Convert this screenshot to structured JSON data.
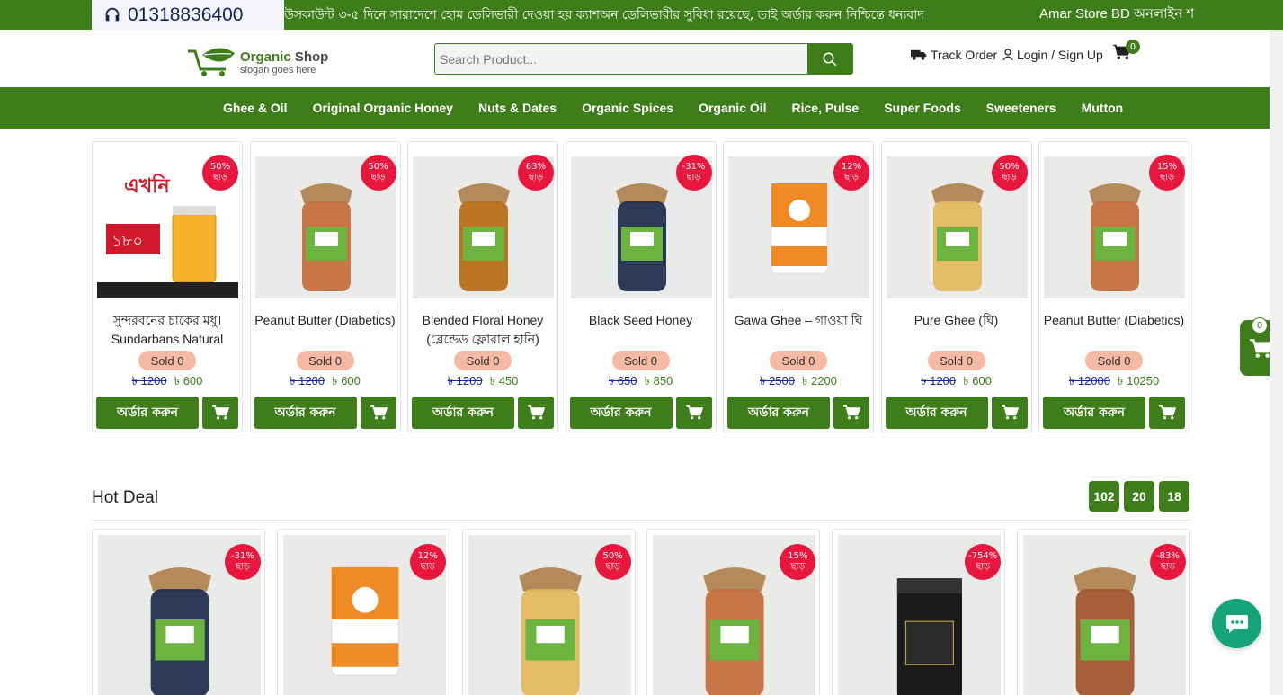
{
  "topbar": {
    "phone": "01318836400",
    "marquee": "উসকাউন্ট ৩-৫ দিনে সারাদেশে হোম ডেলিভারী দেওয়া হয় ক্যাশঅন ডেলিভারীর সুবিধা রয়েছে, তাই অর্ডার করুন নিশ্চিন্তে ধন্যবাদ",
    "store_text": "Amar Store BD অনলাইন শ"
  },
  "header": {
    "logo_name_1": "Organic",
    "logo_name_2": " Shop",
    "logo_slogan": "slogan goes here",
    "search_placeholder": "Search Product...",
    "track_order": "Track Order",
    "login": "Login / Sign Up",
    "cart_count": "0"
  },
  "nav": {
    "items": [
      "Ghee & Oil",
      "Original Organic Honey",
      "Nuts & Dates",
      "Organic Spices",
      "Organic Oil",
      "Rice, Pulse",
      "Super Foods",
      "Sweeteners",
      "Mutton"
    ]
  },
  "labels": {
    "order_button": "অর্ডার করুন",
    "sold": "Sold 0",
    "discount_suffix": "ছাড়"
  },
  "products": [
    {
      "title": "সুন্দরবনের চাকের মধু। Sundarbans Natural",
      "discount": "50%",
      "old_price": "৳ 1200",
      "new_price": "৳ 600",
      "img": "promo"
    },
    {
      "title": "Peanut Butter (Diabetics)",
      "discount": "50%",
      "old_price": "৳ 1200",
      "new_price": "৳ 600",
      "img": "peanut"
    },
    {
      "title": "Blended Floral Honey (ব্লেন্ডেড ফ্লোরাল হানি)",
      "discount": "63%",
      "old_price": "৳ 1200",
      "new_price": "৳ 450",
      "img": "honey"
    },
    {
      "title": "Black Seed Honey",
      "discount": "-31%",
      "old_price": "৳ 650",
      "new_price": "৳ 850",
      "img": "black"
    },
    {
      "title": "Gawa Ghee – গাওয়া ঘি",
      "discount": "12%",
      "old_price": "৳ 2500",
      "new_price": "৳ 2200",
      "img": "tin"
    },
    {
      "title": "Pure Ghee (ঘি)",
      "discount": "50%",
      "old_price": "৳ 1200",
      "new_price": "৳ 600",
      "img": "ghee"
    },
    {
      "title": "Peanut Butter (Diabetics)",
      "discount": "15%",
      "old_price": "৳ 12000",
      "new_price": "৳ 10250",
      "img": "peanut"
    }
  ],
  "hot_deal": {
    "title": "Hot Deal",
    "timer": [
      "102",
      "20",
      "18"
    ],
    "items": [
      {
        "discount": "-31%",
        "img": "black"
      },
      {
        "discount": "12%",
        "img": "tin"
      },
      {
        "discount": "50%",
        "img": "ghee"
      },
      {
        "discount": "15%",
        "img": "peanut"
      },
      {
        "discount": "-754%",
        "img": "darkjar"
      },
      {
        "discount": "-83%",
        "img": "nuts"
      }
    ]
  },
  "floating_cart": {
    "count": "0"
  },
  "colors": {
    "brand_green": "#3e7e1a",
    "discount_red": "#e8173d",
    "sold_badge": "#f6b9a4",
    "chat": "#15a37a"
  }
}
